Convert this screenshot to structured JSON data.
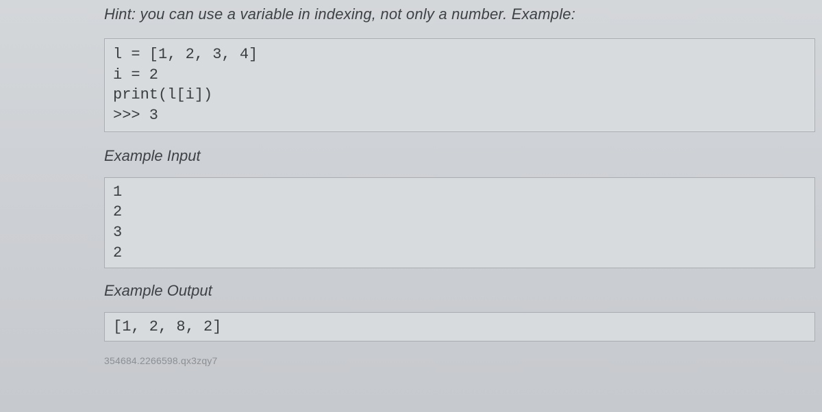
{
  "hint_text": "Hint: you can use a variable in indexing, not only a number. Example:",
  "code_example": "l = [1, 2, 3, 4]\ni = 2\nprint(l[i])\n>>> 3",
  "example_input_label": "Example Input",
  "example_input": "1\n2\n3\n2",
  "example_output_label": "Example Output",
  "example_output": "[1, 2, 8, 2]",
  "footer_id": "354684.2266598.qx3zqy7"
}
